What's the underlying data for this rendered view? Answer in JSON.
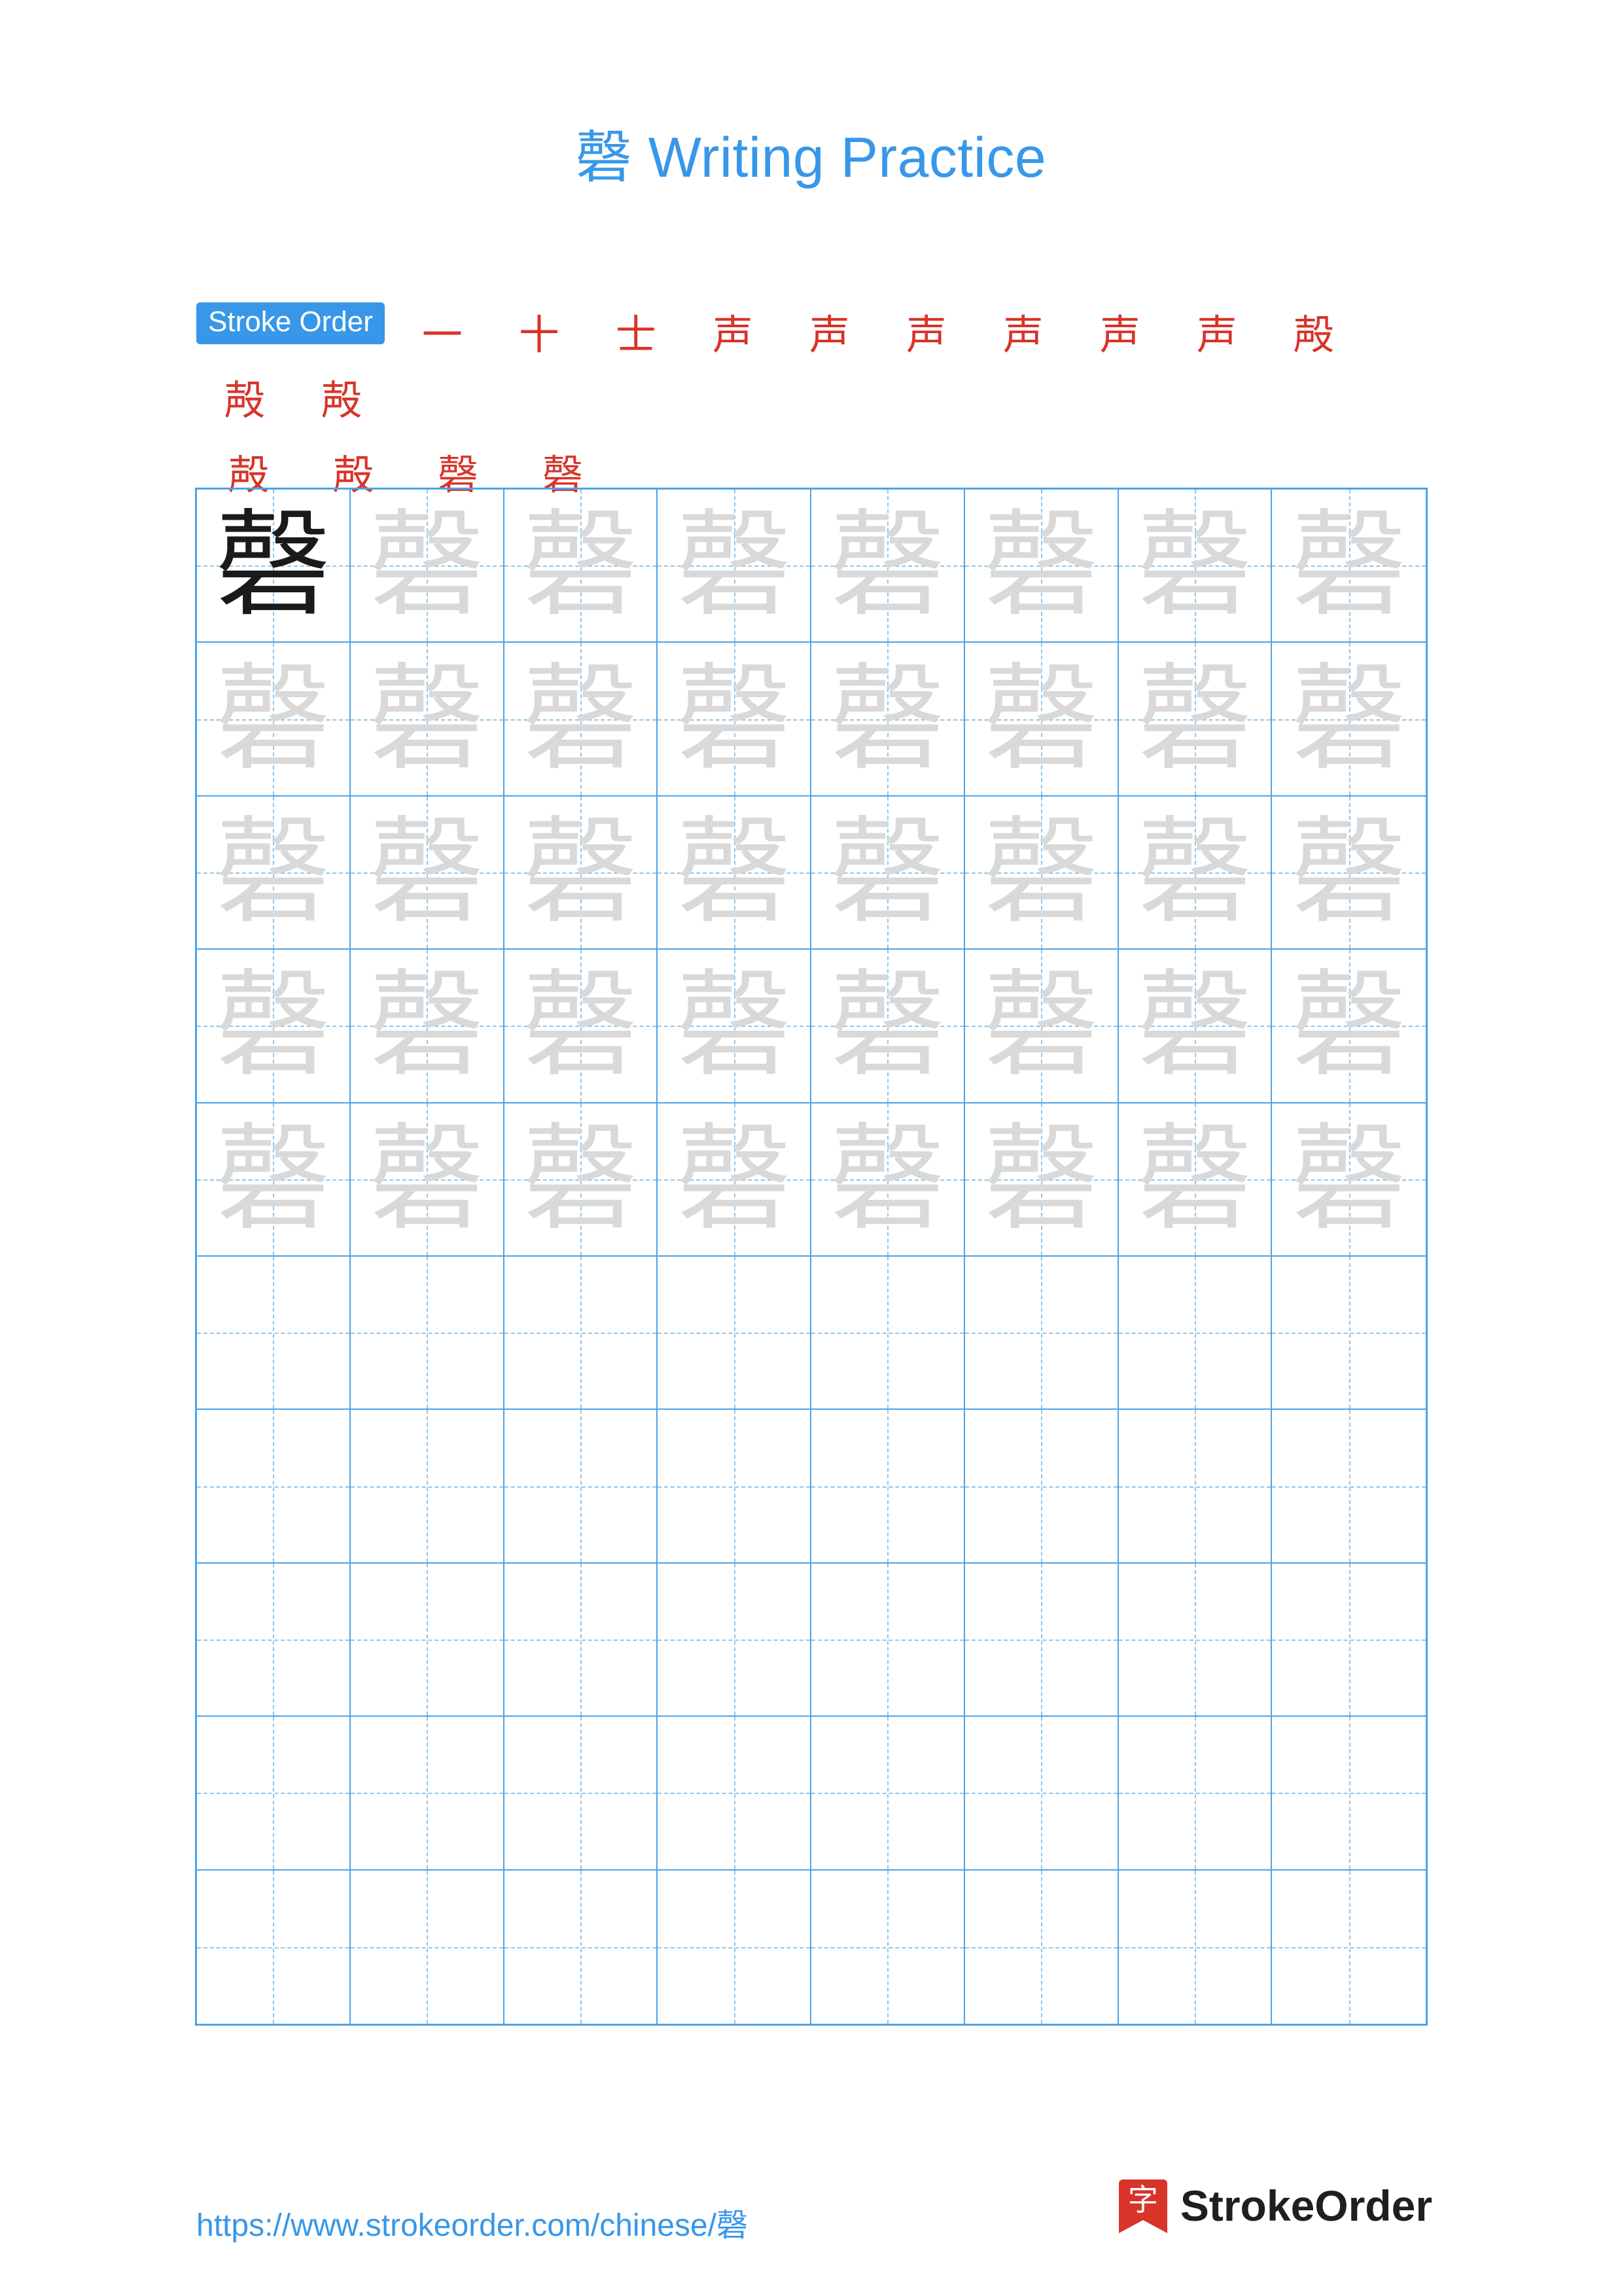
{
  "page": {
    "character": "磬",
    "title": "磬 Writing Practice",
    "background_color": "#ffffff",
    "accent_color": "#3897e8",
    "stroke_color": "#d8342a",
    "grid_line_color": "#4da3e8",
    "ghost_char_color": "#d9d9d9"
  },
  "stroke_order": {
    "label": "Stroke Order",
    "steps_row1": [
      "一",
      "十",
      "士",
      "声",
      "声",
      "声",
      "声",
      "声",
      "声",
      "殸",
      "殸",
      "殸"
    ],
    "steps_row2": [
      "殸",
      "殸",
      "磬",
      "磬"
    ],
    "total_strokes": 16
  },
  "grid": {
    "columns": 8,
    "rows": 10,
    "traced_rows": 5,
    "blank_rows": 5,
    "first_cell_style": "solid",
    "cell_character": "磬"
  },
  "footer": {
    "url": "https://www.strokeorder.com/chinese/磬",
    "brand_name": "StrokeOrder",
    "brand_logo_char": "字"
  }
}
